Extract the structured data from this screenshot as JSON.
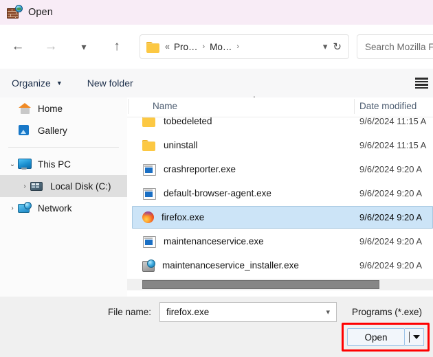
{
  "window": {
    "title": "Open",
    "title_icon": "firewall-globe-icon",
    "titlebar_color": "#f8ecf6"
  },
  "nav": {
    "back_icon": "arrow-left-icon",
    "forward_icon": "arrow-right-icon",
    "recent_icon": "chevron-down-icon",
    "up_icon": "arrow-up-icon",
    "breadcrumb": {
      "folder_icon": "folder-icon",
      "overflow": "«",
      "items": [
        {
          "label": "Pro…",
          "sep": "›"
        },
        {
          "label": "Mo…",
          "sep": "›"
        }
      ],
      "dropdown_icon": "chevron-down-icon",
      "refresh_icon": "refresh-icon"
    },
    "search_placeholder": "Search Mozilla Firef"
  },
  "commandbar": {
    "organize": "Organize",
    "organize_caret": "▼",
    "new_folder": "New folder",
    "view_icon": "view-list-icon"
  },
  "sidebar": {
    "items": [
      {
        "label": "Home",
        "icon": "home-icon",
        "arrow": "",
        "indent": 0,
        "selected": false
      },
      {
        "label": "Gallery",
        "icon": "gallery-icon",
        "arrow": "",
        "indent": 0,
        "selected": false
      },
      {
        "separator": true
      },
      {
        "label": "This PC",
        "icon": "pc-icon",
        "arrow": "⌄",
        "indent": 0,
        "selected": false
      },
      {
        "label": "Local Disk (C:)",
        "icon": "disk-icon",
        "arrow": "›",
        "indent": 1,
        "selected": true
      },
      {
        "label": "Network",
        "icon": "network-icon",
        "arrow": "›",
        "indent": 0,
        "selected": false
      }
    ]
  },
  "filelist": {
    "columns": [
      "Name",
      "Date modified"
    ],
    "sort_caret": "˄",
    "rows": [
      {
        "name": "tobedeleted",
        "icon": "folder-icon",
        "date": "9/6/2024 11:15 A",
        "selected": false
      },
      {
        "name": "uninstall",
        "icon": "folder-icon",
        "date": "9/6/2024 11:15 A",
        "selected": false
      },
      {
        "name": "crashreporter.exe",
        "icon": "exe-icon",
        "date": "9/6/2024 9:20 A",
        "selected": false
      },
      {
        "name": "default-browser-agent.exe",
        "icon": "exe-icon",
        "date": "9/6/2024 9:20 A",
        "selected": false
      },
      {
        "name": "firefox.exe",
        "icon": "firefox-icon",
        "date": "9/6/2024 9:20 A",
        "selected": true
      },
      {
        "name": "maintenanceservice.exe",
        "icon": "exe-icon",
        "date": "9/6/2024 9:20 A",
        "selected": false
      },
      {
        "name": "maintenanceservice_installer.exe",
        "icon": "maint-icon",
        "date": "9/6/2024 9:20 A",
        "selected": false
      }
    ]
  },
  "footer": {
    "filename_label": "File name:",
    "filename_value": "firefox.exe",
    "filename_dropdown_icon": "chevron-down-icon",
    "filter_value": "Programs (*.exe)",
    "open_label": "Open",
    "open_split_icon": "caret-down-icon",
    "highlight_color": "#ff0000"
  }
}
